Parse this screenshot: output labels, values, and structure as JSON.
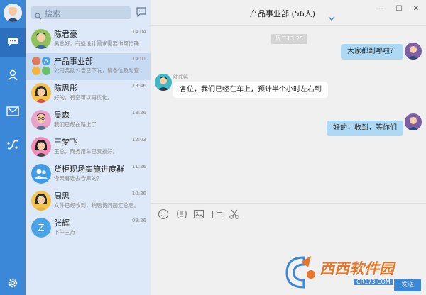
{
  "search": {
    "placeholder": "搜索"
  },
  "conversations": [
    {
      "name": "陈君豪",
      "time": "14:04",
      "preview": "吴总好，有些设计需求需要你帮忙确",
      "avatar": "man-avatar"
    },
    {
      "name": "产品事业部",
      "time": "14:01",
      "preview": "公司奖励公告已下发，请各位及时查",
      "avatar": "group-avatar",
      "selected": true
    },
    {
      "name": "陈思彤",
      "time": "13:46",
      "preview": "好的，有空可以再优化。",
      "avatar": "woman-avatar"
    },
    {
      "name": "吴森",
      "time": "13:26",
      "preview": "我们已经在路上了",
      "avatar": "man-glasses-avatar"
    },
    {
      "name": "王梦飞",
      "time": "12:03",
      "preview": "王总，商务用车已安排好。",
      "avatar": "woman-avatar"
    },
    {
      "name": "货柜现场实施进度群",
      "time": "11:26",
      "preview": "今天有谁去仓库的？",
      "avatar": "group-avatar"
    },
    {
      "name": "周思",
      "time": "10:26",
      "preview": "文件已经收到，稍后将问题汇总后。",
      "avatar": "woman-avatar"
    },
    {
      "name": "张辉",
      "time": "09:26",
      "preview": "下午三点",
      "avatar": "letter-avatar",
      "letter": "Z"
    }
  ],
  "chat": {
    "title": "产品事业部 (56人)",
    "time_divider": "周二13:25",
    "messages": [
      {
        "from": "me",
        "text": "大家都到哪啦？"
      },
      {
        "from": "other",
        "sender": "陆成铭",
        "text": "各位，我们已经在车上，预计半个小时左右到"
      },
      {
        "from": "me",
        "text": "好的，收到，等你们"
      }
    ],
    "send_label": "发送"
  },
  "window": {
    "minimize": "—",
    "maximize": "☐",
    "close": "✕"
  },
  "watermark": {
    "text": "西西软件园",
    "url": "CR173.COM"
  },
  "colors": {
    "nav": "#3b87d8",
    "list": "#dde9f8",
    "bubble_me": "#aed9f5",
    "bubble_other": "#ffffff"
  }
}
